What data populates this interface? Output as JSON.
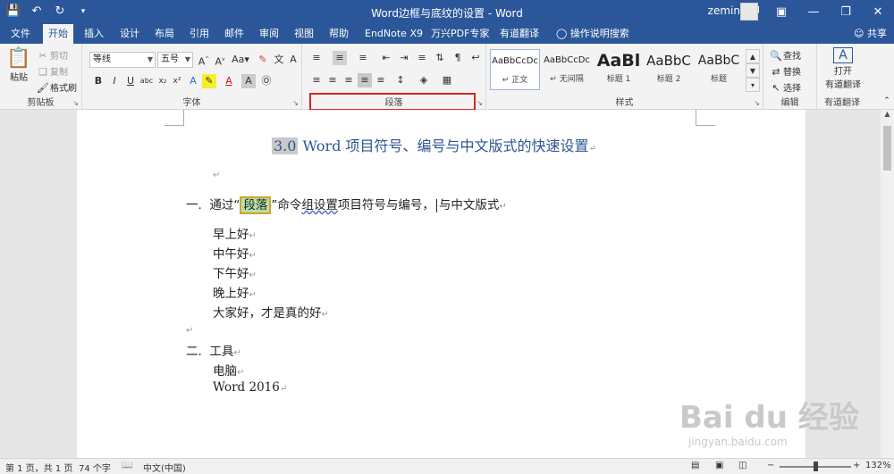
{
  "window": {
    "title": "Word边框与底纹的设置 - Word",
    "user": "zemin OU"
  },
  "tabs": [
    "文件",
    "开始",
    "插入",
    "设计",
    "布局",
    "引用",
    "邮件",
    "审阅",
    "视图",
    "帮助",
    "EndNote X9",
    "万兴PDF专家",
    "有道翻译",
    "操作说明搜索"
  ],
  "share_label": "共享",
  "clipboard": {
    "paste": "粘贴",
    "cut": "剪切",
    "copy": "复制",
    "format_painter": "格式刷",
    "label": "剪贴板"
  },
  "font": {
    "name": "等线",
    "size": "五号",
    "label": "字体"
  },
  "paragraph": {
    "label": "段落"
  },
  "styles": {
    "items": [
      {
        "sample": "AaBbCcDc",
        "label": "↵ 正文"
      },
      {
        "sample": "AaBbCcDc",
        "label": "↵ 无间隔"
      },
      {
        "sample": "AaBl",
        "label": "标题 1"
      },
      {
        "sample": "AaBbC",
        "label": "标题 2"
      },
      {
        "sample": "AaBbC",
        "label": "标题"
      }
    ],
    "label": "样式"
  },
  "editing": {
    "find": "查找",
    "replace": "替换",
    "select": "选择",
    "label": "编辑"
  },
  "youdao": {
    "open": "打开",
    "translate": "有道翻译",
    "label": "有道翻译"
  },
  "document": {
    "heading_num": "3.0",
    "heading_text": "Word 项目符号、编号与中文版式的快速设置",
    "item1_num": "一.",
    "item1_pre": "通过“",
    "item1_hl": "段落",
    "item1_mid": "”命令",
    "item1_wavy": "组设置",
    "item1_post": "项目符号与编号，",
    "item1_end": "与中文版式",
    "lines": [
      "早上好",
      "中午好",
      "下午好",
      "晚上好",
      "大家好，才是真的好"
    ],
    "item2_num": "二.",
    "item2_text": "工具",
    "tools": [
      "电脑",
      "Word 2016"
    ]
  },
  "status": {
    "page": "第 1 页，共 1 页",
    "words": "74 个字",
    "lang": "中文(中国)",
    "zoom": "132%"
  },
  "watermark": {
    "brand": "Bai du 经验",
    "url": "jingyan.baidu.com"
  }
}
